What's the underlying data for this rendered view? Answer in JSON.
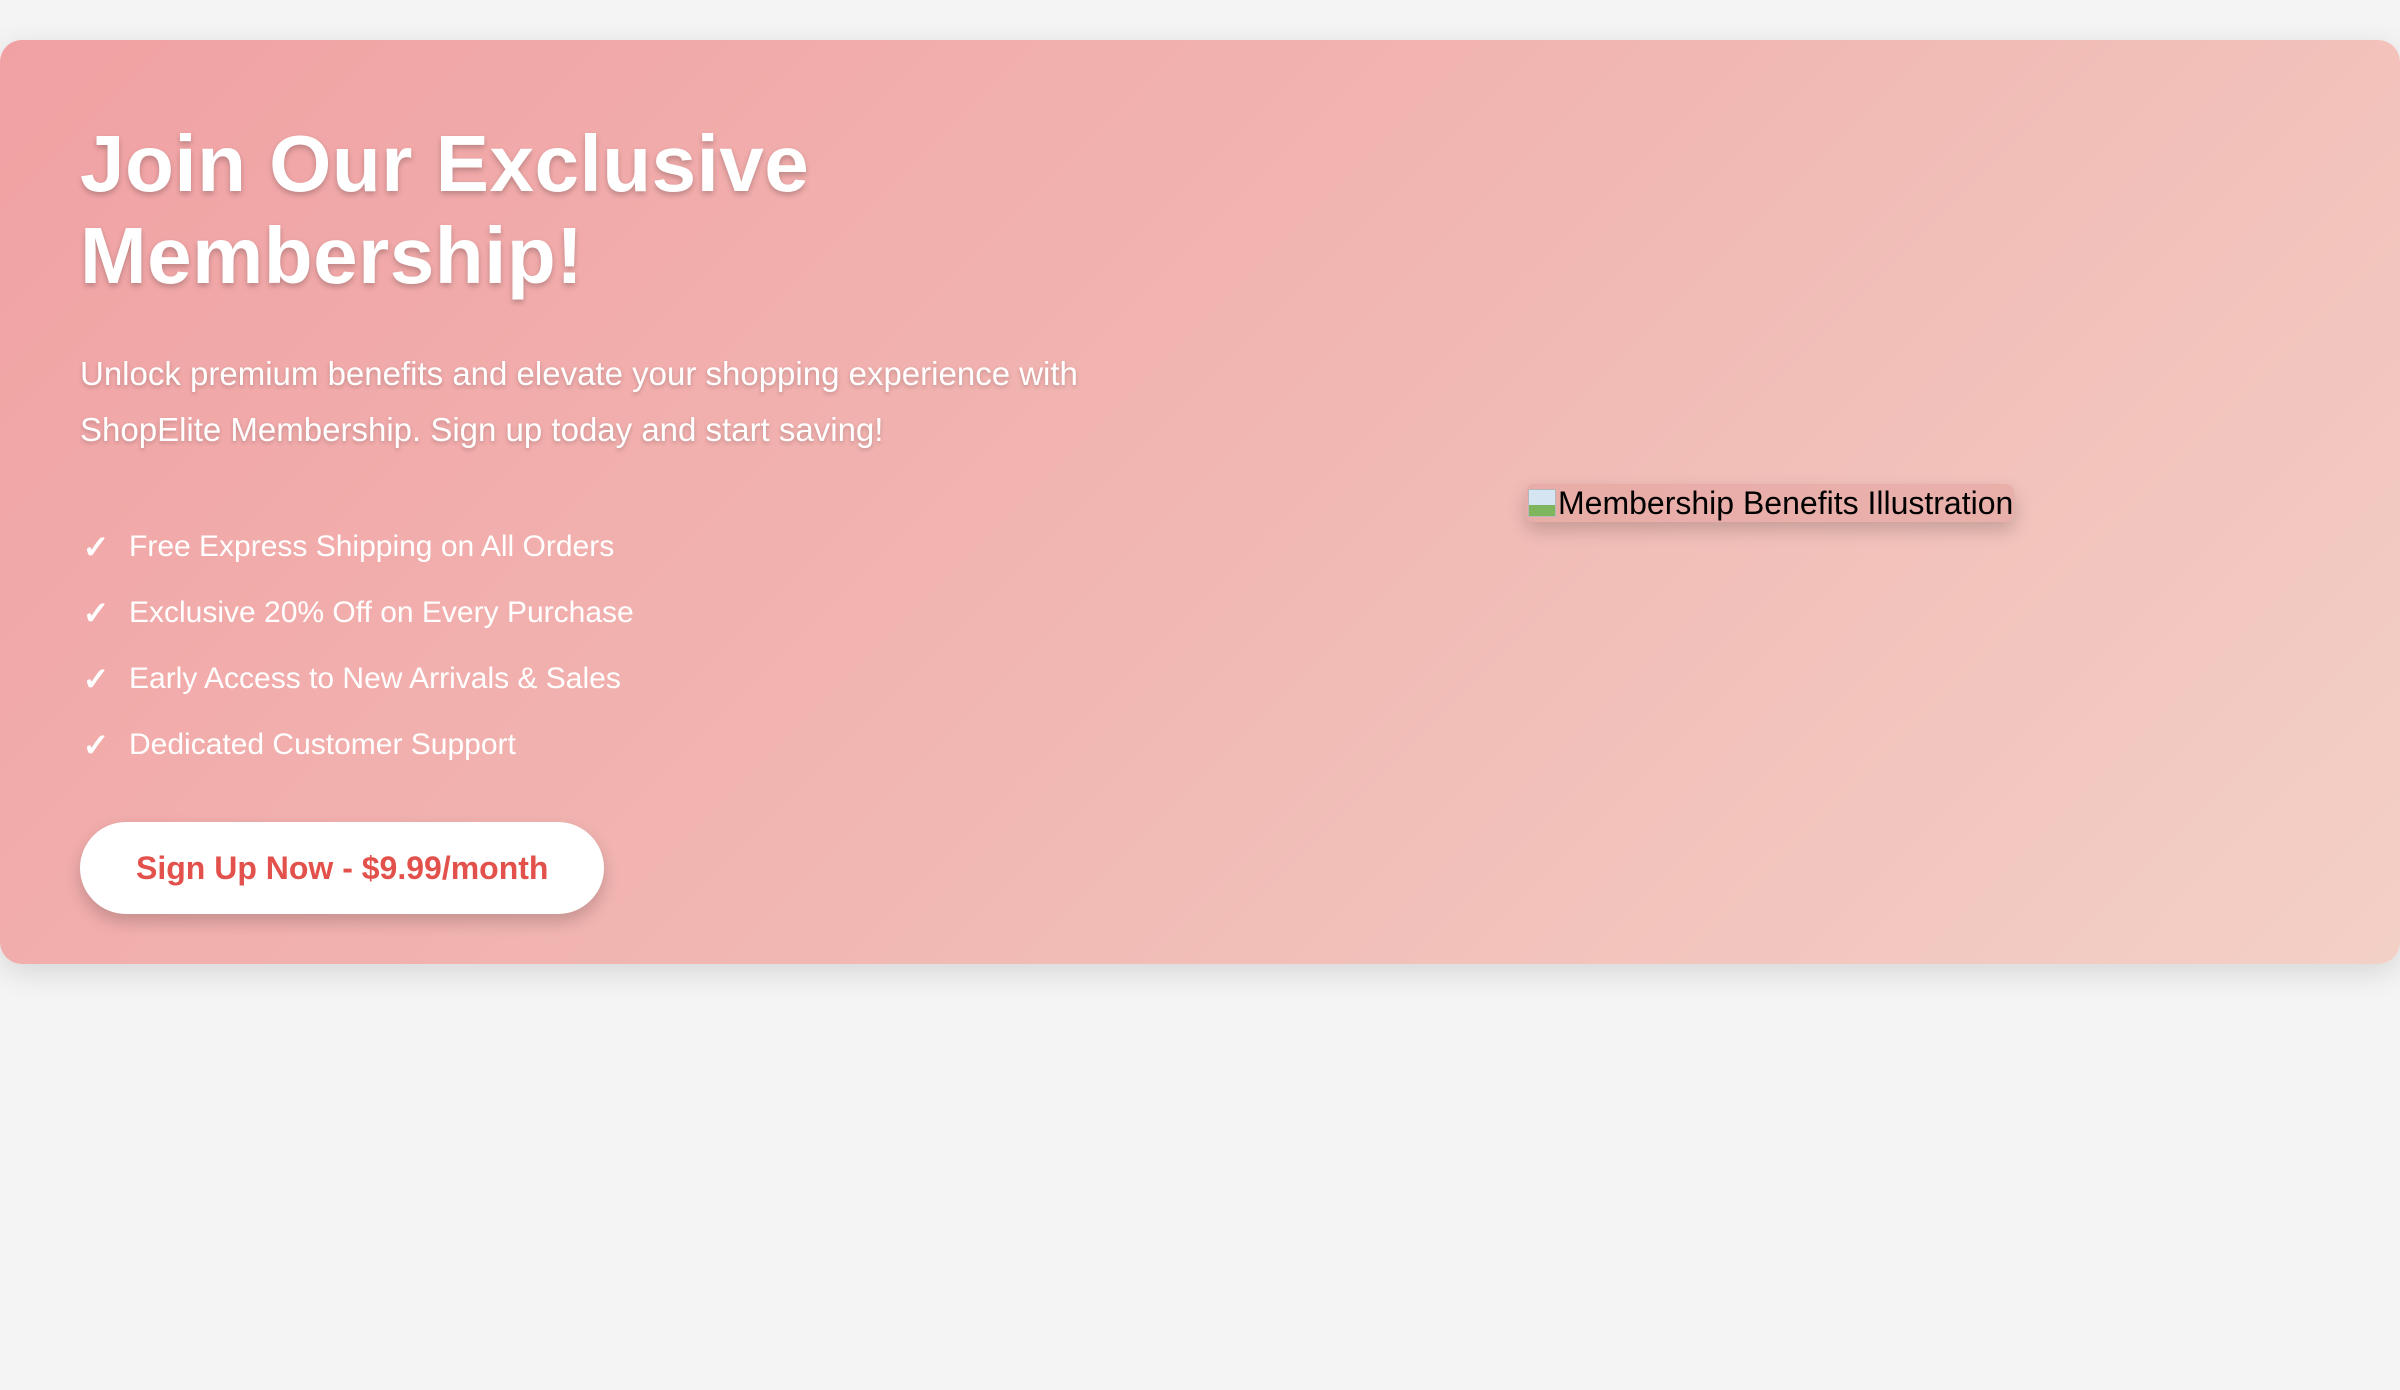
{
  "hero": {
    "title": "Join Our Exclusive Membership!",
    "subtitle": "Unlock premium benefits and elevate your shopping experience with ShopElite Membership. Sign up today and start saving!",
    "benefits": [
      {
        "icon": "checkmark-icon",
        "label": "Free Express Shipping on All Orders"
      },
      {
        "icon": "checkmark-icon",
        "label": "Exclusive 20% Off on Every Purchase"
      },
      {
        "icon": "checkmark-icon",
        "label": "Early Access to New Arrivals & Sales"
      },
      {
        "icon": "checkmark-icon",
        "label": "Dedicated Customer Support"
      }
    ],
    "check_glyph": "✓",
    "cta_label": "Sign Up Now - $9.99/month",
    "image_alt": "Membership Benefits Illustration"
  },
  "colors": {
    "page_background": "#f4f4f4",
    "hero_gradient_start": "#f1a1a3",
    "hero_gradient_end": "#f3d0c6",
    "cta_text": "#e2514b",
    "cta_background": "#ffffff"
  }
}
